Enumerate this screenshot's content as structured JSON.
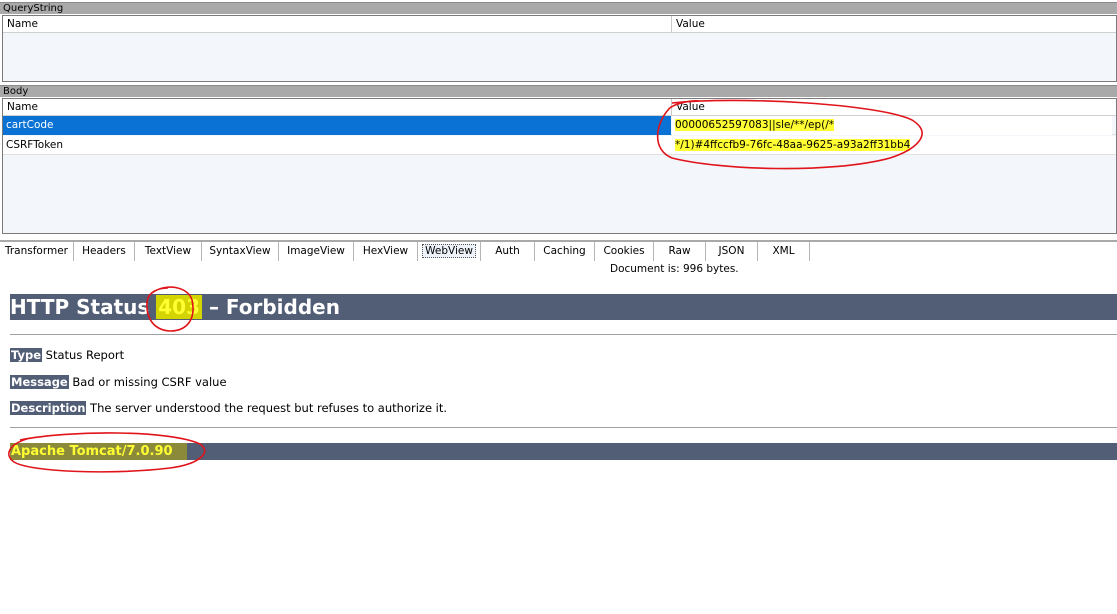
{
  "querystring": {
    "title": "QueryString",
    "columns": [
      "Name",
      "Value"
    ]
  },
  "body_section": {
    "title": "Body",
    "columns": [
      "Name",
      "Value"
    ],
    "rows": [
      {
        "name": "cartCode",
        "value": "00000652597083||sle/**/ep(/*"
      },
      {
        "name": "CSRFToken",
        "value": "*/1)#4ffccfb9-76fc-48aa-9625-a93a2ff31bb4"
      }
    ]
  },
  "tabs": [
    "Transformer",
    "Headers",
    "TextView",
    "SyntaxView",
    "ImageView",
    "HexView",
    "WebView",
    "Auth",
    "Caching",
    "Cookies",
    "Raw",
    "JSON",
    "XML"
  ],
  "active_tab": "WebView",
  "document_info": "Document is: 996 bytes.",
  "webview": {
    "title_prefix": "HTTP Status ",
    "status_code": "403",
    "title_suffix": " – Forbidden",
    "type_label": "Type",
    "type_value": " Status Report",
    "message_label": "Message",
    "message_value": " Bad or missing CSRF value",
    "description_label": "Description",
    "description_value": " The server understood the request but refuses to authorize it.",
    "server": "Apache Tomcat/7.0.90"
  },
  "colors": {
    "tomcat_banner": "#525d76",
    "highlight": "#ffff33",
    "selection": "#0a72d4",
    "annotation": "#e0141a"
  }
}
